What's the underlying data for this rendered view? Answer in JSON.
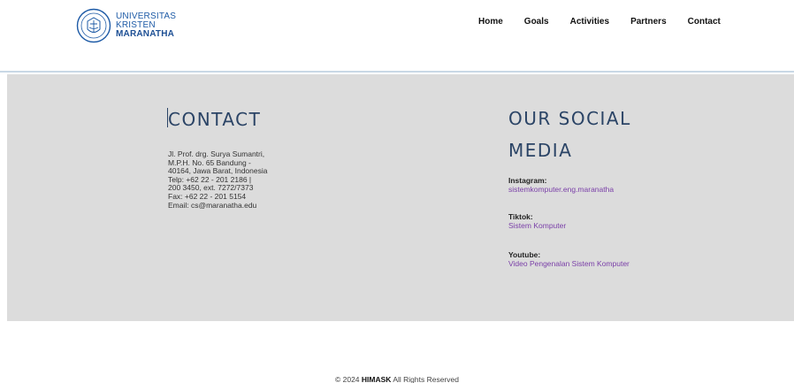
{
  "header": {
    "logo": {
      "line1": "UNIVERSITAS",
      "line2": "KRISTEN",
      "line3": "MARANATHA",
      "icon": "university-seal-icon"
    },
    "nav": [
      "Home",
      "Goals",
      "Activities",
      "Partners",
      "Contact"
    ]
  },
  "contact": {
    "title": "CONTACT",
    "address": "Jl. Prof. drg. Surya Sumantri,\nM.P.H. No. 65 Bandung -\n40164, Jawa Barat, Indonesia\nTelp: +62 22 - 201 2186 |\n200 3450, ext. 7272/7373\nFax: +62 22 - 201 5154\nEmail: cs@maranatha.edu"
  },
  "social": {
    "title": "OUR SOCIAL MEDIA",
    "items": [
      {
        "label": "Instagram:",
        "value": "sistemkomputer.eng.maranatha"
      },
      {
        "label": "Tiktok:",
        "value": "Sistem Komputer"
      },
      {
        "label": "Youtube:",
        "value": "Video Pengenalan Sistem Komputer"
      }
    ]
  },
  "footer": {
    "prefix": "© 2024 ",
    "brand": "HIMASK",
    "suffix": " All Rights Reserved"
  },
  "colors": {
    "band": "#dcdcdc",
    "title": "#2b4466",
    "link": "#7a3fa8",
    "logo": "#1d5aa6"
  }
}
